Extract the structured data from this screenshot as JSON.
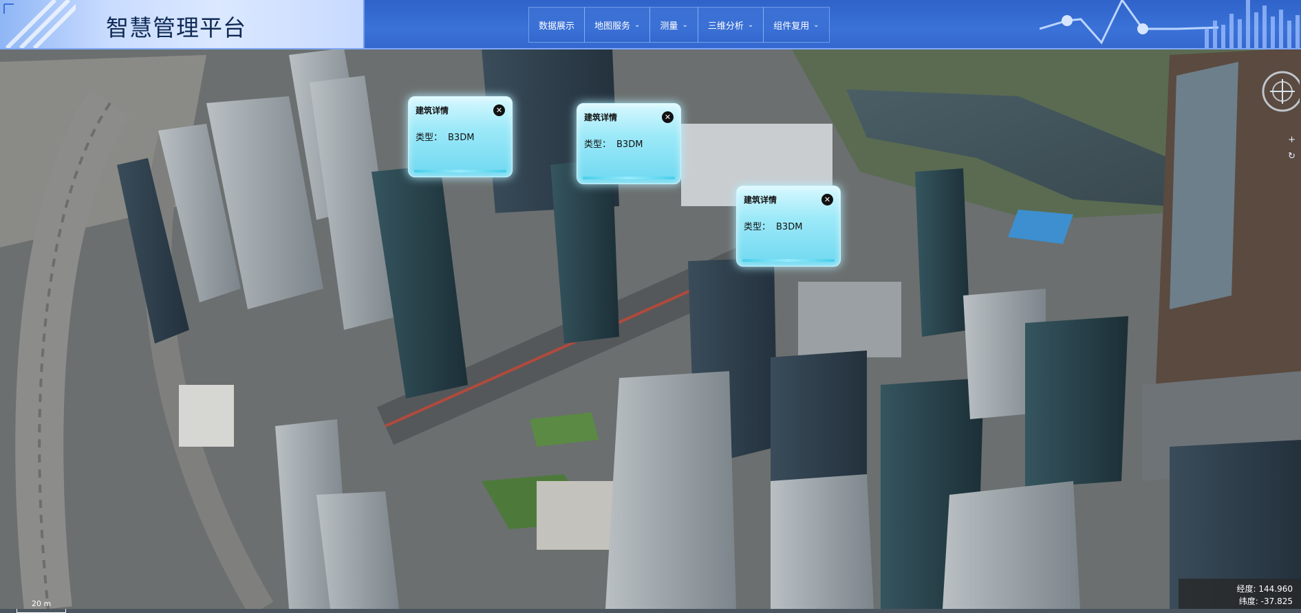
{
  "app": {
    "title": "智慧管理平台"
  },
  "nav": [
    {
      "label": "数据展示",
      "has_dropdown": false
    },
    {
      "label": "地图服务",
      "has_dropdown": true
    },
    {
      "label": "测量",
      "has_dropdown": true
    },
    {
      "label": "三维分析",
      "has_dropdown": true
    },
    {
      "label": "组件复用",
      "has_dropdown": true
    }
  ],
  "popups": [
    {
      "title": "建筑详情",
      "type_label": "类型：",
      "type_value": "B3DM",
      "close": "✕"
    },
    {
      "title": "建筑详情",
      "type_label": "类型：",
      "type_value": "B3DM",
      "close": "✕"
    },
    {
      "title": "建筑详情",
      "type_label": "类型：",
      "type_value": "B3DM",
      "close": "✕"
    }
  ],
  "controls": {
    "zoom_in": "+",
    "reset": "↻"
  },
  "status": {
    "longitude_label": "经度:",
    "longitude": "144.960",
    "latitude_label": "纬度:",
    "latitude": "-37.825",
    "scale": "20 m"
  },
  "icons": {
    "compass": "compass-icon",
    "close": "close-icon",
    "chevron": "chevron-down-icon"
  },
  "colors": {
    "header": "#3a72d8",
    "popup": "#9ce9f8",
    "accent": "#7fa8ff"
  }
}
